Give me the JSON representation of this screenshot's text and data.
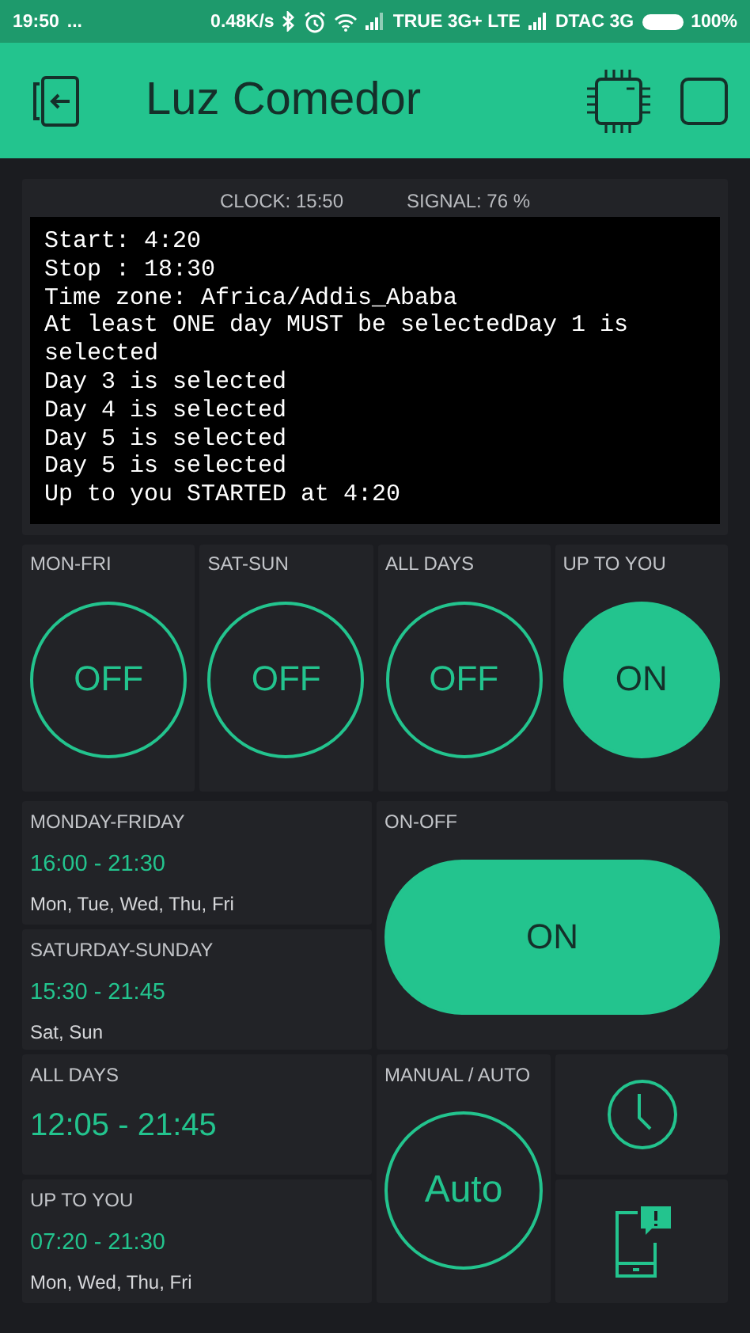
{
  "status_bar": {
    "time": "19:50",
    "dots": "...",
    "speed": "0.48K/s",
    "carrier_1": "TRUE 3G+ LTE",
    "carrier_2": "DTAC 3G",
    "battery": "100%"
  },
  "header": {
    "title": "Luz Comedor"
  },
  "device": {
    "clock": "CLOCK:  15:50",
    "signal": "SIGNAL:  76 %"
  },
  "terminal": [
    "Start: 4:20",
    "Stop : 18:30",
    "Time zone: Africa/Addis_Ababa",
    "At least ONE day MUST be selectedDay 1 is selected",
    "Day 3 is selected",
    "Day 4 is selected",
    "Day 5 is selected",
    "Day 5 is selected",
    "Up to you STARTED at 4:20"
  ],
  "buttons": [
    {
      "label": "MON-FRI",
      "text": "OFF",
      "on": false
    },
    {
      "label": "SAT-SUN",
      "text": "OFF",
      "on": false
    },
    {
      "label": "ALL DAYS",
      "text": "OFF",
      "on": false
    },
    {
      "label": "UP TO YOU",
      "text": "ON",
      "on": true
    }
  ],
  "timers": [
    {
      "kind": "small",
      "label": "MONDAY-FRIDAY",
      "time": "16:00 - 21:30",
      "days": "Mon, Tue, Wed, Thu, Fri"
    },
    {
      "kind": "small",
      "label": "SATURDAY-SUNDAY",
      "time": "15:30 - 21:45",
      "days": "Sat, Sun"
    },
    {
      "kind": "large",
      "label": "ALL DAYS",
      "time": "12:05 - 21:45"
    },
    {
      "kind": "small",
      "label": "UP TO YOU",
      "time": "07:20 - 21:30",
      "days": "Mon, Wed, Thu, Fri"
    }
  ],
  "on_off": {
    "label": "ON-OFF",
    "text": "ON",
    "on": true
  },
  "mode": {
    "label": "MANUAL / AUTO",
    "text": "Auto",
    "on": false
  }
}
